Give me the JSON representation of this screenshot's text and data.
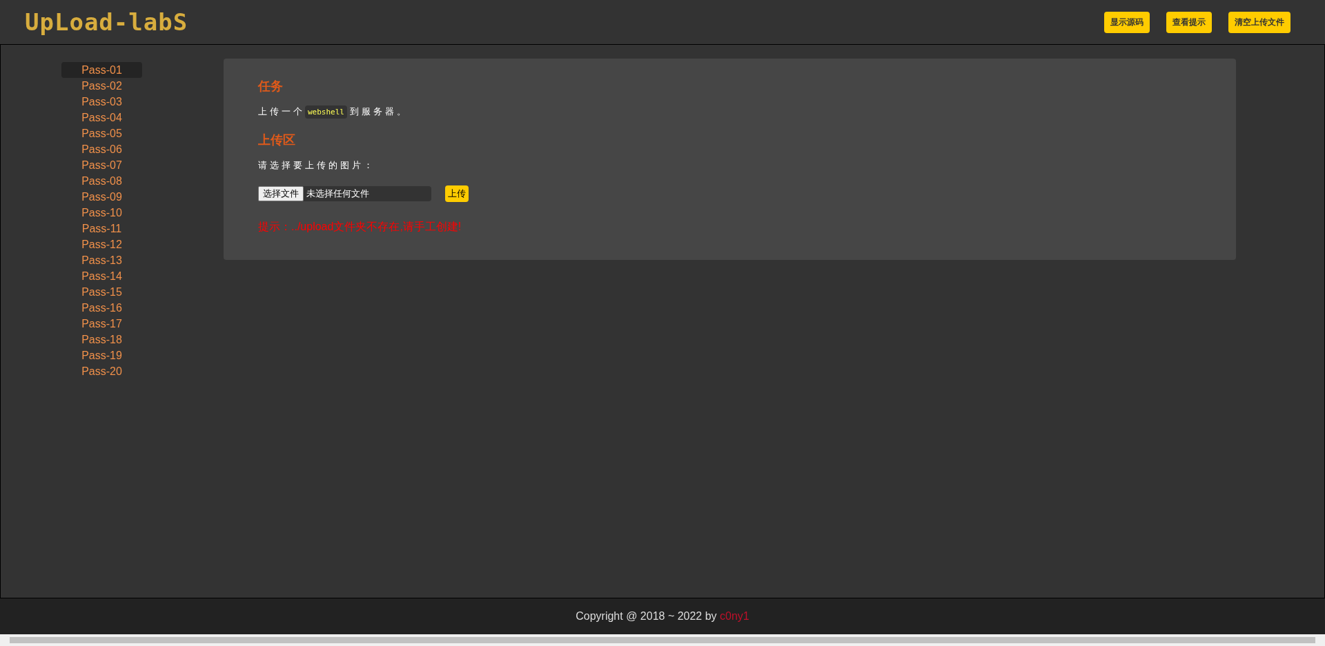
{
  "header": {
    "logo": "UpLoad-labS",
    "buttons": [
      "显示源码",
      "查看提示",
      "清空上传文件"
    ]
  },
  "sidebar": {
    "items": [
      {
        "label": "Pass-01",
        "selected": true
      },
      {
        "label": "Pass-02",
        "selected": false
      },
      {
        "label": "Pass-03",
        "selected": false
      },
      {
        "label": "Pass-04",
        "selected": false
      },
      {
        "label": "Pass-05",
        "selected": false
      },
      {
        "label": "Pass-06",
        "selected": false
      },
      {
        "label": "Pass-07",
        "selected": false
      },
      {
        "label": "Pass-08",
        "selected": false
      },
      {
        "label": "Pass-09",
        "selected": false
      },
      {
        "label": "Pass-10",
        "selected": false
      },
      {
        "label": "Pass-11",
        "selected": false
      },
      {
        "label": "Pass-12",
        "selected": false
      },
      {
        "label": "Pass-13",
        "selected": false
      },
      {
        "label": "Pass-14",
        "selected": false
      },
      {
        "label": "Pass-15",
        "selected": false
      },
      {
        "label": "Pass-16",
        "selected": false
      },
      {
        "label": "Pass-17",
        "selected": false
      },
      {
        "label": "Pass-18",
        "selected": false
      },
      {
        "label": "Pass-19",
        "selected": false
      },
      {
        "label": "Pass-20",
        "selected": false
      }
    ]
  },
  "task": {
    "heading": "任务",
    "text_before": "上传一个",
    "code": "webshell",
    "text_after": "到服务器。"
  },
  "upload": {
    "heading": "上传区",
    "prompt": "请选择要上传的图片：",
    "choose_button": "选择文件",
    "file_status": "未选择任何文件",
    "submit": "上传",
    "tip": "提示：../upload文件夹不存在,请手工创建!"
  },
  "footer": {
    "text": "Copyright @ 2018 ~ 2022 by",
    "author": "c0ny1"
  }
}
